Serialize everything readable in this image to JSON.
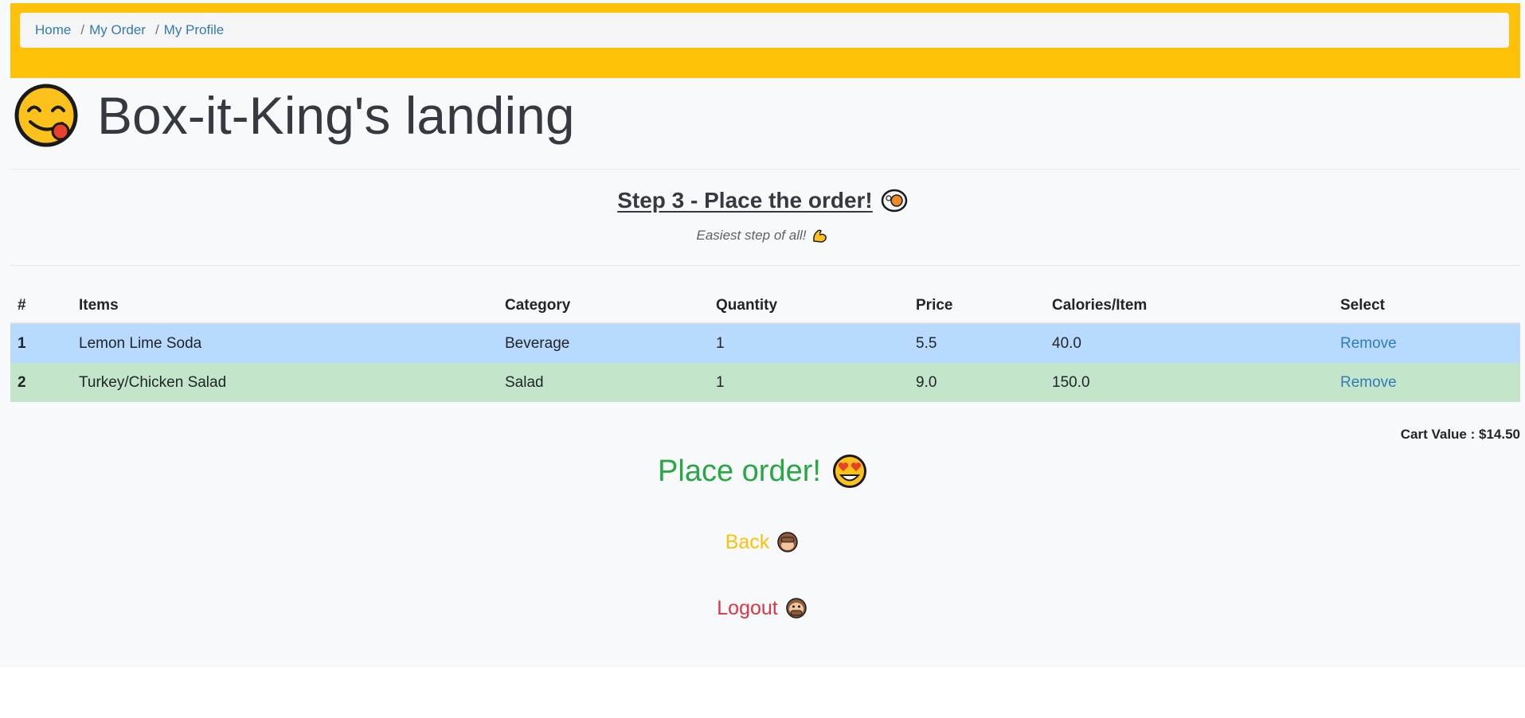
{
  "breadcrumb": {
    "items": [
      "Home",
      "My Order",
      "My Profile"
    ],
    "separator": "/"
  },
  "header": {
    "title": "Box-it-King's landing",
    "emoji_icon": "face-savoring-food-icon"
  },
  "step": {
    "title": "Step 3 - Place the order!",
    "title_icon": "bento-icon",
    "subtitle": "Easiest step of all!",
    "subtitle_icon": "flexed-biceps-icon"
  },
  "table": {
    "headers": [
      "#",
      "Items",
      "Category",
      "Quantity",
      "Price",
      "Calories/Item",
      "Select"
    ],
    "rows": [
      {
        "num": "1",
        "item": "Lemon Lime Soda",
        "category": "Beverage",
        "quantity": "1",
        "price": "5.5",
        "calories": "40.0",
        "action": "Remove"
      },
      {
        "num": "2",
        "item": "Turkey/Chicken Salad",
        "category": "Salad",
        "quantity": "1",
        "price": "9.0",
        "calories": "150.0",
        "action": "Remove"
      }
    ]
  },
  "cart": {
    "label": "Cart Value : $14.50"
  },
  "actions": {
    "place_order": "Place order!",
    "place_order_icon": "heart-eyes-icon",
    "back": "Back",
    "back_icon": "see-no-evil-monkey-icon",
    "logout": "Logout",
    "logout_icon": "speak-no-evil-monkey-icon"
  },
  "colors": {
    "topbar": "#ffc107",
    "row_1": "#b8daff",
    "row_2": "#c3e6cb",
    "place_order": "#28a745",
    "back": "#ffc107",
    "logout": "#dc3545",
    "link": "#337ab7"
  }
}
